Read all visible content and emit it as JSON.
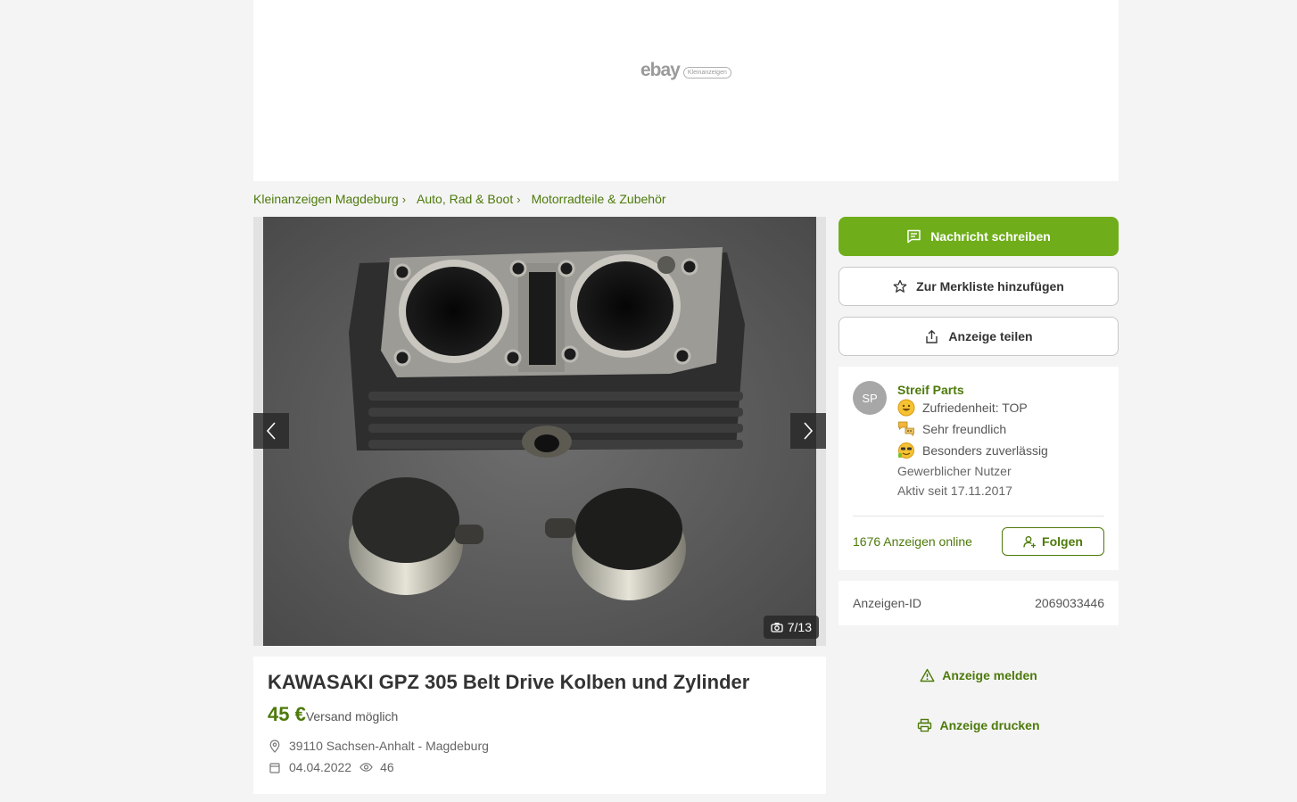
{
  "ad": {
    "brand": "ebay",
    "sub_brand": "Kleinanzeigen"
  },
  "breadcrumb": [
    {
      "label": "Kleinanzeigen Magdeburg"
    },
    {
      "label": "Auto, Rad & Boot"
    },
    {
      "label": "Motorradteile & Zubehör"
    }
  ],
  "gallery": {
    "counter": "7/13",
    "prev_icon": "chevron-left-icon",
    "next_icon": "chevron-right-icon",
    "camera_icon": "camera-icon"
  },
  "listing": {
    "title": "KAWASAKI GPZ 305 Belt Drive Kolben und Zylinder",
    "price": "45 €",
    "shipping": "Versand möglich",
    "location": "39110 Sachsen-Anhalt - Magdeburg",
    "date": "04.04.2022",
    "views": "46"
  },
  "actions": {
    "message": "Nachricht schreiben",
    "watchlist": "Zur Merkliste hinzufügen",
    "share": "Anzeige teilen",
    "report": "Anzeige melden",
    "print": "Anzeige drucken"
  },
  "seller": {
    "initials": "SP",
    "name": "Streif Parts",
    "badges": [
      {
        "label": "Zufriedenheit: TOP",
        "icon": "smiley-icon"
      },
      {
        "label": "Sehr freundlich",
        "icon": "chat-bubbles-icon"
      },
      {
        "label": "Besonders zuverlässig",
        "icon": "reliable-icon"
      }
    ],
    "type": "Gewerblicher Nutzer",
    "active_since": "Aktiv seit 17.11.2017",
    "ads_online": "1676 Anzeigen online",
    "follow": "Folgen"
  },
  "ad_id": {
    "label": "Anzeigen-ID",
    "value": "2069033446"
  },
  "colors": {
    "brand_green": "#6fae1a",
    "link_green": "#4d7a0a",
    "background": "#f4f4f4"
  }
}
